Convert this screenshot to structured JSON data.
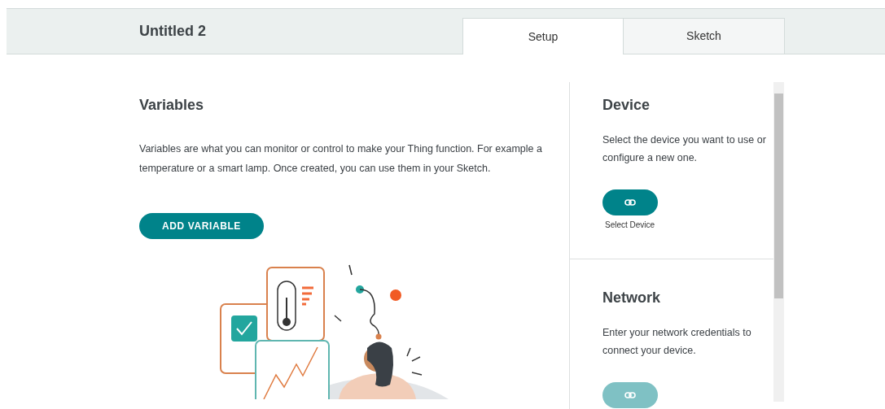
{
  "header": {
    "title": "Untitled 2"
  },
  "tabs": [
    {
      "label": "Setup",
      "selected": true
    },
    {
      "label": "Sketch",
      "selected": false
    }
  ],
  "variables": {
    "title": "Variables",
    "description": "Variables are what you can monitor or control to make your Thing function. For example a temperature or a smart lamp. Once created, you can use them in your Sketch.",
    "button": "ADD VARIABLE"
  },
  "sections": [
    {
      "title": "Device",
      "description": "Select the device you want to use or configure a new one.",
      "disabled": false,
      "caption": "Select Device"
    },
    {
      "title": "Network",
      "description": "Enter your network credentials to connect your device.",
      "disabled": true
    }
  ]
}
